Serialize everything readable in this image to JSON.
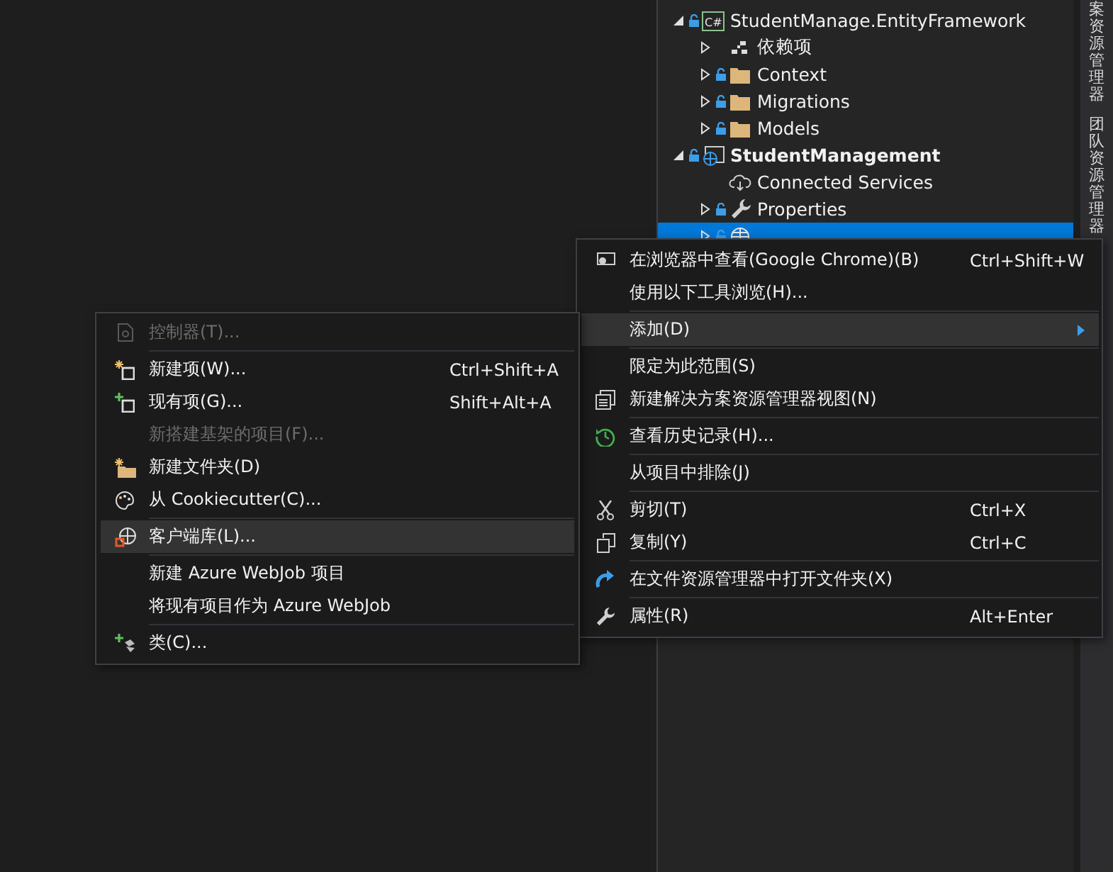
{
  "solution_explorer": {
    "tree": [
      {
        "label": "StudentManage.EntityFramework",
        "kind": "cs-project",
        "icon_text": "C#",
        "expanded": true,
        "locked": true,
        "startup": false,
        "selected": false,
        "children": [
          {
            "label": "依赖项",
            "kind": "dependencies",
            "expanded": false,
            "locked": false,
            "selected": false
          },
          {
            "label": "Context",
            "kind": "folder",
            "expanded": false,
            "locked": true,
            "selected": false
          },
          {
            "label": "Migrations",
            "kind": "folder",
            "expanded": false,
            "locked": true,
            "selected": false
          },
          {
            "label": "Models",
            "kind": "folder",
            "expanded": false,
            "locked": true,
            "selected": false
          }
        ]
      },
      {
        "label": "StudentManagement",
        "kind": "web-project",
        "expanded": true,
        "locked": true,
        "startup": true,
        "selected": false,
        "children": [
          {
            "label": "Connected Services",
            "kind": "service",
            "locked": false,
            "selected": false
          },
          {
            "label": "Properties",
            "kind": "properties",
            "expanded": false,
            "locked": true,
            "selected": false
          },
          {
            "kind": "webroot",
            "expanded": false,
            "locked": true,
            "selected": true
          }
        ]
      }
    ]
  },
  "side_tabs": [
    "案资源管理器",
    "团队资源管理器"
  ],
  "context_menu": {
    "items": [
      {
        "kind": "item",
        "label": "在浏览器中查看(Google Chrome)(B)",
        "shortcut": "Ctrl+Shift+W",
        "selected": false,
        "disabled": false
      },
      {
        "kind": "item",
        "label": "使用以下工具浏览(H)...",
        "selected": false,
        "disabled": false
      },
      {
        "kind": "separator"
      },
      {
        "kind": "item",
        "label": "添加(D)",
        "selected": true,
        "disabled": false,
        "submenu": true
      },
      {
        "kind": "separator"
      },
      {
        "kind": "item",
        "label": "限定为此范围(S)",
        "selected": false,
        "disabled": false
      },
      {
        "kind": "item",
        "label": "新建解决方案资源管理器视图(N)",
        "selected": false,
        "disabled": false
      },
      {
        "kind": "separator"
      },
      {
        "kind": "item",
        "label": "查看历史记录(H)...",
        "selected": false,
        "disabled": false
      },
      {
        "kind": "separator"
      },
      {
        "kind": "item",
        "label": "从项目中排除(J)",
        "selected": false,
        "disabled": false
      },
      {
        "kind": "separator"
      },
      {
        "kind": "item",
        "label": "剪切(T)",
        "shortcut": "Ctrl+X",
        "selected": false,
        "disabled": false
      },
      {
        "kind": "item",
        "label": "复制(Y)",
        "shortcut": "Ctrl+C",
        "selected": false,
        "disabled": false
      },
      {
        "kind": "separator"
      },
      {
        "kind": "item",
        "label": "在文件资源管理器中打开文件夹(X)",
        "selected": false,
        "disabled": false
      },
      {
        "kind": "separator"
      },
      {
        "kind": "item",
        "label": "属性(R)",
        "shortcut": "Alt+Enter",
        "selected": false,
        "disabled": false
      }
    ]
  },
  "add_submenu": {
    "items": [
      {
        "kind": "item",
        "label": "控制器(T)...",
        "selected": false,
        "disabled": true
      },
      {
        "kind": "separator"
      },
      {
        "kind": "item",
        "label": "新建项(W)...",
        "shortcut": "Ctrl+Shift+A",
        "selected": false,
        "disabled": false
      },
      {
        "kind": "item",
        "label": "现有项(G)...",
        "shortcut": "Shift+Alt+A",
        "selected": false,
        "disabled": false
      },
      {
        "kind": "item",
        "label": "新搭建基架的项目(F)...",
        "selected": false,
        "disabled": true
      },
      {
        "kind": "item",
        "label": "新建文件夹(D)",
        "selected": false,
        "disabled": false
      },
      {
        "kind": "item",
        "label": "从 Cookiecutter(C)...",
        "selected": false,
        "disabled": false
      },
      {
        "kind": "separator"
      },
      {
        "kind": "item",
        "label": "客户端库(L)...",
        "selected": true,
        "disabled": false
      },
      {
        "kind": "separator"
      },
      {
        "kind": "item",
        "label": "新建 Azure WebJob 项目",
        "selected": false,
        "disabled": false
      },
      {
        "kind": "item",
        "label": "将现有项目作为 Azure WebJob",
        "selected": false,
        "disabled": false
      },
      {
        "kind": "separator"
      },
      {
        "kind": "item",
        "label": "类(C)...",
        "selected": false,
        "disabled": false
      }
    ]
  }
}
